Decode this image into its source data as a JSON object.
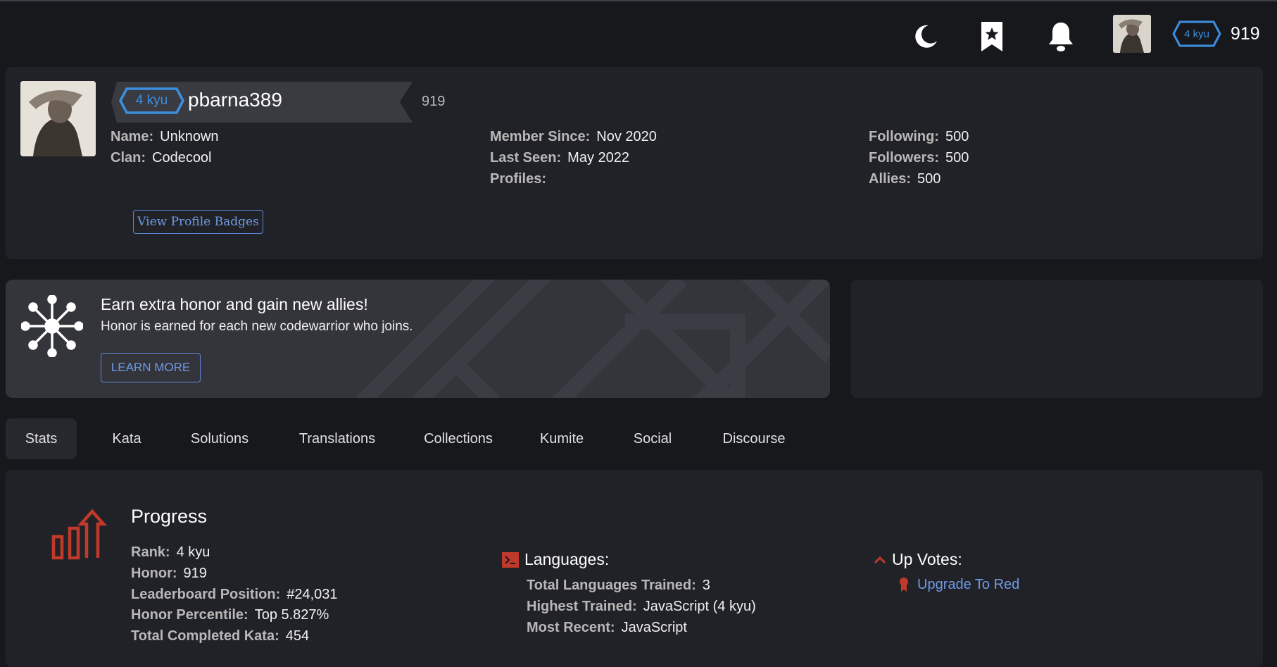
{
  "topbar": {
    "theme_icon": "moon-icon",
    "bookmark_icon": "bookmark-star-icon",
    "notification_icon": "bell-icon",
    "rank": "4 kyu",
    "honor": "919"
  },
  "profile": {
    "rank": "4 kyu",
    "username": "pbarna389",
    "honor": "919",
    "fields": {
      "name": {
        "label": "Name:",
        "value": "Unknown"
      },
      "clan": {
        "label": "Clan:",
        "value": "Codecool"
      },
      "member_since": {
        "label": "Member Since:",
        "value": "Nov 2020"
      },
      "last_seen": {
        "label": "Last Seen:",
        "value": "May 2022"
      },
      "profiles": {
        "label": "Profiles:",
        "value": ""
      },
      "following": {
        "label": "Following:",
        "value": "500"
      },
      "followers": {
        "label": "Followers:",
        "value": "500"
      },
      "allies": {
        "label": "Allies:",
        "value": "500"
      }
    },
    "badges_button": "View Profile Badges"
  },
  "promo": {
    "icon": "network-icon",
    "title": "Earn extra honor and gain new allies!",
    "subtitle": "Honor is earned for each new codewarrior who joins.",
    "button": "LEARN MORE"
  },
  "tabs": [
    {
      "label": "Stats",
      "active": true
    },
    {
      "label": "Kata"
    },
    {
      "label": "Solutions"
    },
    {
      "label": "Translations"
    },
    {
      "label": "Collections"
    },
    {
      "label": "Kumite"
    },
    {
      "label": "Social"
    },
    {
      "label": "Discourse"
    }
  ],
  "stats": {
    "progress": {
      "icon": "progress-chart-icon",
      "title": "Progress",
      "rank": {
        "label": "Rank:",
        "value": "4 kyu"
      },
      "honor": {
        "label": "Honor:",
        "value": "919"
      },
      "leaderboard": {
        "label": "Leaderboard Position:",
        "value": "#24,031"
      },
      "percentile": {
        "label": "Honor Percentile:",
        "value": "Top 5.827%"
      },
      "completed": {
        "label": "Total Completed Kata:",
        "value": "454"
      }
    },
    "languages": {
      "icon": "terminal-icon",
      "title": "Languages:",
      "trained": {
        "label": "Total Languages Trained:",
        "value": "3"
      },
      "highest": {
        "label": "Highest Trained:",
        "value": "JavaScript (4 kyu)"
      },
      "recent": {
        "label": "Most Recent:",
        "value": "JavaScript"
      }
    },
    "upvotes": {
      "icon": "chevron-up-icon",
      "title": "Up Votes:",
      "link_icon": "ribbon-icon",
      "link": "Upgrade To Red"
    }
  },
  "colors": {
    "accent_blue": "#3c8fe0",
    "link_blue": "#6f9ae6",
    "accent_red": "#c0392b",
    "background": "#17181c",
    "card": "#212227"
  }
}
